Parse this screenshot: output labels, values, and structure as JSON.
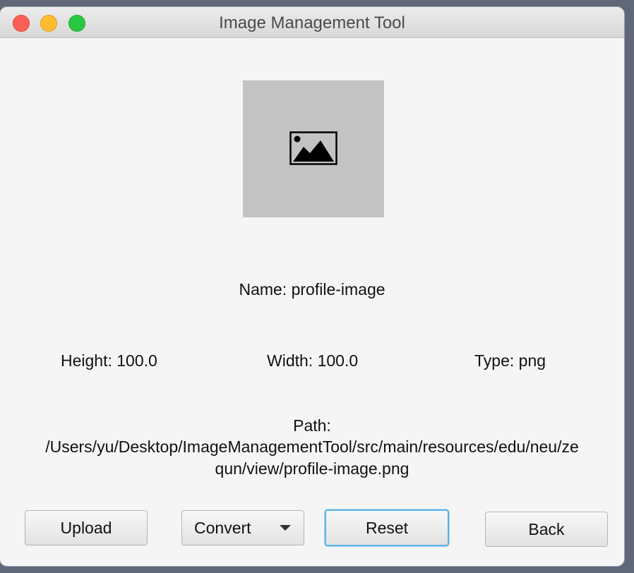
{
  "window": {
    "title": "Image Management Tool"
  },
  "image": {
    "icon": "image-placeholder-icon"
  },
  "info": {
    "name_label": "Name:",
    "name_value": "profile-image",
    "height_label": "Height:",
    "height_value": "100.0",
    "width_label": "Width:",
    "width_value": "100.0",
    "type_label": "Type:",
    "type_value": "png",
    "path_label": "Path:",
    "path_line1": "/Users/yu/Desktop/ImageManagementTool/src/main/resources/edu/neu/ze",
    "path_line2": "qun/view/profile-image.png"
  },
  "buttons": {
    "upload": "Upload",
    "convert": "Convert",
    "reset": "Reset",
    "back": "Back"
  },
  "colors": {
    "close": "#fe5f57",
    "minimize": "#febc2e",
    "maximize": "#28c840",
    "focus_ring": "#5fb4e6"
  }
}
